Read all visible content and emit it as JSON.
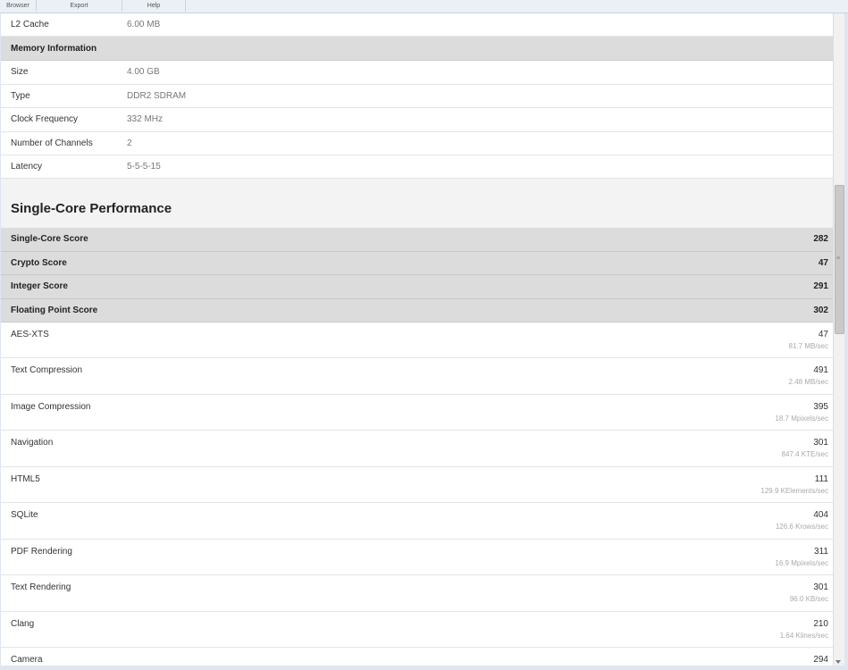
{
  "menu": [
    "Browser",
    "Export",
    "Help"
  ],
  "processor_tail": {
    "key": "L2 Cache",
    "value": "6.00 MB"
  },
  "memory": {
    "header": "Memory Information",
    "rows": [
      {
        "key": "Size",
        "value": "4.00 GB"
      },
      {
        "key": "Type",
        "value": "DDR2 SDRAM"
      },
      {
        "key": "Clock Frequency",
        "value": "332 MHz"
      },
      {
        "key": "Number of Channels",
        "value": "2"
      },
      {
        "key": "Latency",
        "value": "5-5-5-15"
      }
    ]
  },
  "single_core": {
    "title": "Single-Core Performance",
    "summary": [
      {
        "label": "Single-Core Score",
        "score": "282"
      },
      {
        "label": "Crypto Score",
        "score": "47"
      },
      {
        "label": "Integer Score",
        "score": "291"
      },
      {
        "label": "Floating Point Score",
        "score": "302"
      }
    ],
    "benchmarks": [
      {
        "label": "AES-XTS",
        "score": "47",
        "rate": "81.7 MB/sec"
      },
      {
        "label": "Text Compression",
        "score": "491",
        "rate": "2.48 MB/sec"
      },
      {
        "label": "Image Compression",
        "score": "395",
        "rate": "18.7 Mpixels/sec"
      },
      {
        "label": "Navigation",
        "score": "301",
        "rate": "847.4 KTE/sec"
      },
      {
        "label": "HTML5",
        "score": "111",
        "rate": "129.9 KElements/sec"
      },
      {
        "label": "SQLite",
        "score": "404",
        "rate": "126.6 Krows/sec"
      },
      {
        "label": "PDF Rendering",
        "score": "311",
        "rate": "16.9 Mpixels/sec"
      },
      {
        "label": "Text Rendering",
        "score": "301",
        "rate": "96.0 KB/sec"
      },
      {
        "label": "Clang",
        "score": "210",
        "rate": "1.64 Klines/sec"
      },
      {
        "label": "Camera",
        "score": "294",
        "rate": ""
      }
    ]
  },
  "icons": {
    "scroll_grip": "grip-lines-icon",
    "scroll_down": "arrow-down-icon"
  },
  "colors": {
    "header_bg": "#dcdcdc",
    "title_bg": "#f3f3f3",
    "rate_text": "#aaaaaa"
  }
}
